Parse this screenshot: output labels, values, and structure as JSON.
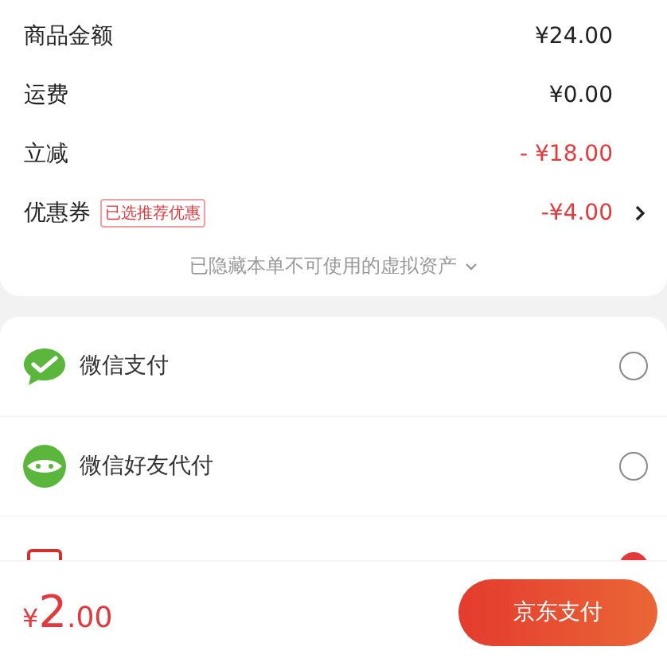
{
  "summary": [
    {
      "label": "商品金额",
      "value": "¥24.00",
      "kind": "plain"
    },
    {
      "label": "运费",
      "value": "¥0.00",
      "kind": "plain"
    },
    {
      "label": "立减",
      "value": "- ¥18.00",
      "kind": "discount"
    },
    {
      "label": "优惠券",
      "tag": "已选推荐优惠",
      "value": "-¥4.00",
      "kind": "coupon"
    }
  ],
  "hidden_assets": {
    "text": "已隐藏本单不可使用的虚拟资产"
  },
  "payment_methods": [
    {
      "label": "微信支付",
      "kind": "wechat",
      "selected": false
    },
    {
      "label": "微信好友代付",
      "kind": "friend",
      "selected": false
    },
    {
      "kind": "card",
      "selected": true
    }
  ],
  "total": {
    "currency": "¥",
    "integer": "2",
    "decimal": ".00"
  },
  "pay_button": "京东支付"
}
